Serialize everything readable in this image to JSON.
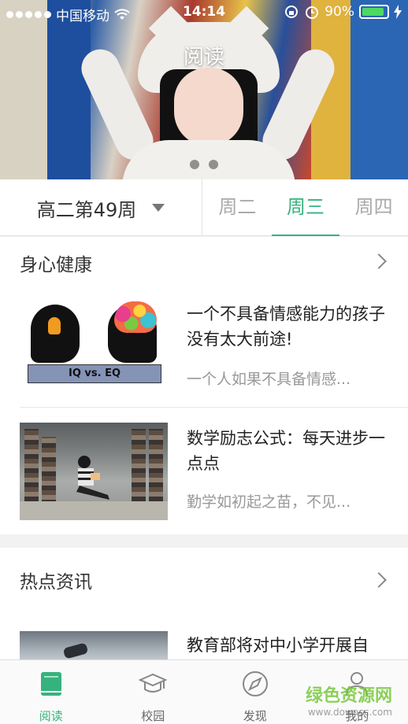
{
  "status_bar": {
    "carrier": "中国移动",
    "time": "14:14",
    "battery": "90%",
    "battery_level": 0.9
  },
  "hero": {
    "title": "阅读",
    "page_count": 2
  },
  "week_selector": {
    "label": "高二第49周",
    "days": [
      "周二",
      "周三",
      "周四"
    ],
    "active_day": "周三"
  },
  "sections": [
    {
      "title": "身心健康",
      "articles": [
        {
          "title": "一个不具备情感能力的孩子没有太大前途!",
          "summary": "一个人如果不具备情感...",
          "thumb_text": "IQ vs. EQ"
        },
        {
          "title": "数学励志公式：每天进步一点点",
          "summary": "勤学如初起之苗，不见..."
        }
      ]
    },
    {
      "title": "热点资讯",
      "articles": [
        {
          "title": "教育部将对中小学开展自"
        }
      ]
    }
  ],
  "tab_bar": {
    "tabs": [
      "阅读",
      "校园",
      "发现",
      "我的"
    ],
    "active": "阅读"
  },
  "watermark": {
    "text": "绿色资源网",
    "url": "www.downcc.com"
  },
  "colors": {
    "accent": "#35b37e",
    "inactive_text": "#aaaaaa"
  }
}
